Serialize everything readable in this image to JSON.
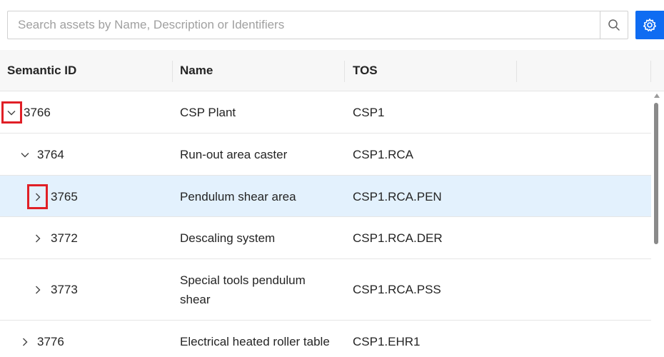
{
  "search": {
    "placeholder": "Search assets by Name, Description or Identifiers",
    "value": ""
  },
  "icons": {
    "search": "search-icon",
    "settings": "gear-icon",
    "expanded": "chevron-down-icon",
    "collapsed": "chevron-right-icon"
  },
  "colors": {
    "accent": "#0f6cf2",
    "selected_row": "#e3f1fd",
    "highlight_box": "#e01f26"
  },
  "table": {
    "columns": [
      "Semantic ID",
      "Name",
      "TOS",
      ""
    ],
    "rows": [
      {
        "id": "3766",
        "name": "CSP Plant",
        "tos": "CSP1",
        "state": "expanded",
        "level": 0,
        "highlighted_toggle": true,
        "selected": false
      },
      {
        "id": "3764",
        "name": "Run-out area caster",
        "tos": "CSP1.RCA",
        "state": "expanded",
        "level": 1,
        "highlighted_toggle": false,
        "selected": false
      },
      {
        "id": "3765",
        "name": "Pendulum shear area",
        "tos": "CSP1.RCA.PEN",
        "state": "collapsed",
        "level": 2,
        "highlighted_toggle": true,
        "selected": true
      },
      {
        "id": "3772",
        "name": "Descaling system",
        "tos": "CSP1.RCA.DER",
        "state": "collapsed",
        "level": 2,
        "highlighted_toggle": false,
        "selected": false
      },
      {
        "id": "3773",
        "name": "Special tools pendulum shear",
        "tos": "CSP1.RCA.PSS",
        "state": "collapsed",
        "level": 2,
        "highlighted_toggle": false,
        "selected": false
      },
      {
        "id": "3776",
        "name": "Electrical heated roller table",
        "tos": "CSP1.EHR1",
        "state": "collapsed",
        "level": 1,
        "highlighted_toggle": false,
        "selected": false
      }
    ]
  }
}
